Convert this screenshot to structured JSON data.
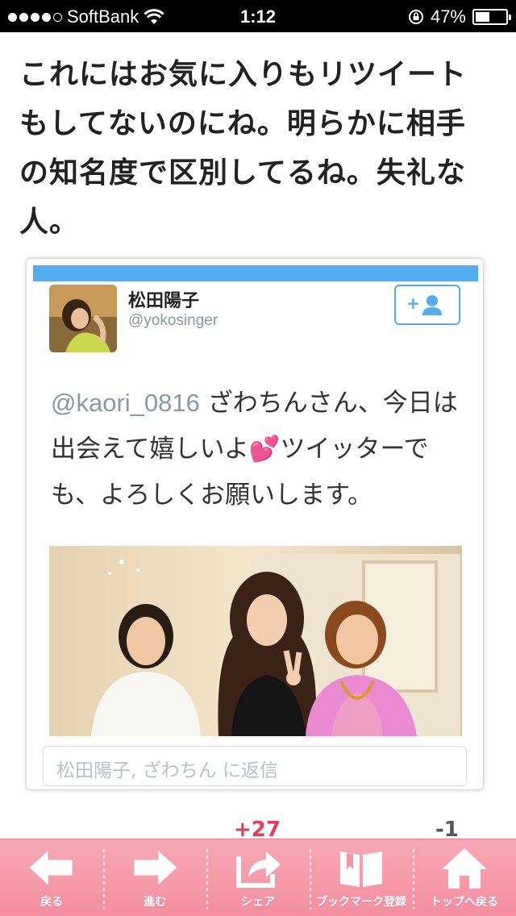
{
  "status_bar": {
    "carrier": "SoftBank",
    "time": "1:12",
    "battery_text": "47%",
    "battery_level": 0.47,
    "signal_strength": 4
  },
  "comment": {
    "text": "これにはお気に入りもリツイートもしてないのにね。明らかに相手の知名度で区別してるね。失礼な人。"
  },
  "tweet": {
    "display_name": "松田陽子",
    "handle": "@yokosinger",
    "mention": "@kaori_0816",
    "text_before_emoji": " ざわちんさん、今日は出会えて嬉しいよ",
    "emoji": "💕",
    "text_after_emoji": "ツイッターでも、よろしくお願いします。",
    "reply_placeholder": "松田陽子, ざわちん に返信",
    "accent_color": "#55acee"
  },
  "partial_stats": {
    "left": "+27",
    "right": "-1"
  },
  "toolbar": {
    "items": [
      {
        "label": "戻る",
        "icon": "arrow-left-icon"
      },
      {
        "label": "進む",
        "icon": "arrow-right-icon"
      },
      {
        "label": "シェア",
        "icon": "share-icon"
      },
      {
        "label": "ブックマーク登録",
        "icon": "bookmark-book-icon"
      },
      {
        "label": "トップへ戻る",
        "icon": "home-icon"
      }
    ],
    "background_color": "#f595a6"
  }
}
